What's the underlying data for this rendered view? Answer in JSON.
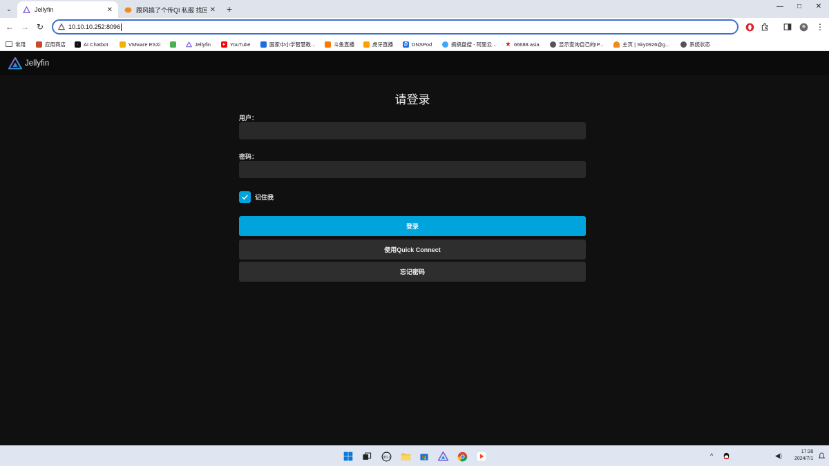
{
  "browser": {
    "tabs": [
      {
        "title": "Jellyfin",
        "active": true
      },
      {
        "title": "跟风搞了个传QI 私服 找回以前",
        "active": false
      }
    ],
    "url": "10.10.10.252:8096",
    "window_controls": {
      "minimize": "—",
      "maximize": "□",
      "close": "✕"
    }
  },
  "bookmarks": [
    {
      "label": "常用",
      "icon": "folder-icon",
      "color": "#555555"
    },
    {
      "label": "应用商店",
      "icon": "store-icon",
      "color": "#c94a2b"
    },
    {
      "label": "AI Chatbot",
      "icon": "chatbot-icon",
      "color": "#111111"
    },
    {
      "label": "VMware ESXi",
      "icon": "vmware-icon",
      "color": "#f2b200"
    },
    {
      "label": "",
      "icon": "app-icon",
      "color": "#4caf50"
    },
    {
      "label": "Jellyfin",
      "icon": "jellyfin-icon",
      "color": "#7b5cd6"
    },
    {
      "label": "YouTube",
      "icon": "youtube-icon",
      "color": "#ff0000"
    },
    {
      "label": "国家中小学智慧教...",
      "icon": "edu-icon",
      "color": "#1a6fe0"
    },
    {
      "label": "斗鱼直播",
      "icon": "douyu-icon",
      "color": "#ff7a00"
    },
    {
      "label": "虎牙直播",
      "icon": "huya-icon",
      "color": "#ffa000"
    },
    {
      "label": "DNSPod",
      "icon": "dnspod-icon",
      "color": "#1e6fe8"
    },
    {
      "label": "搞搞盘搜 - 阿里云...",
      "icon": "pansou-icon",
      "color": "#3ea6ff"
    },
    {
      "label": "66688.asia",
      "icon": "star-icon",
      "color": "#d82020"
    },
    {
      "label": "显示查询自己的IP...",
      "icon": "globe-icon",
      "color": "#555555"
    },
    {
      "label": "主页 | Sky0926@g...",
      "icon": "cloud-icon",
      "color": "#f08a1e"
    },
    {
      "label": "系统状态",
      "icon": "globe-icon",
      "color": "#555555"
    }
  ],
  "app": {
    "logo_text": "Jellyfin",
    "accent": "#00a4dc"
  },
  "login": {
    "title": "请登录",
    "username_label": "用户：",
    "username_value": "",
    "password_label": "密码：",
    "password_value": "",
    "remember_label": "记住我",
    "remember_checked": true,
    "login_button": "登录",
    "quick_connect_button": "使用Quick Connect",
    "forgot_password_button": "忘记密码"
  },
  "taskbar": {
    "apps": [
      "windows-start-icon",
      "task-view-icon",
      "dell-icon",
      "file-explorer-icon",
      "store-icon",
      "jellyfin-icon",
      "chrome-icon",
      "media-player-icon"
    ],
    "clock_time": "17:38",
    "clock_date": "2024/7/1"
  }
}
